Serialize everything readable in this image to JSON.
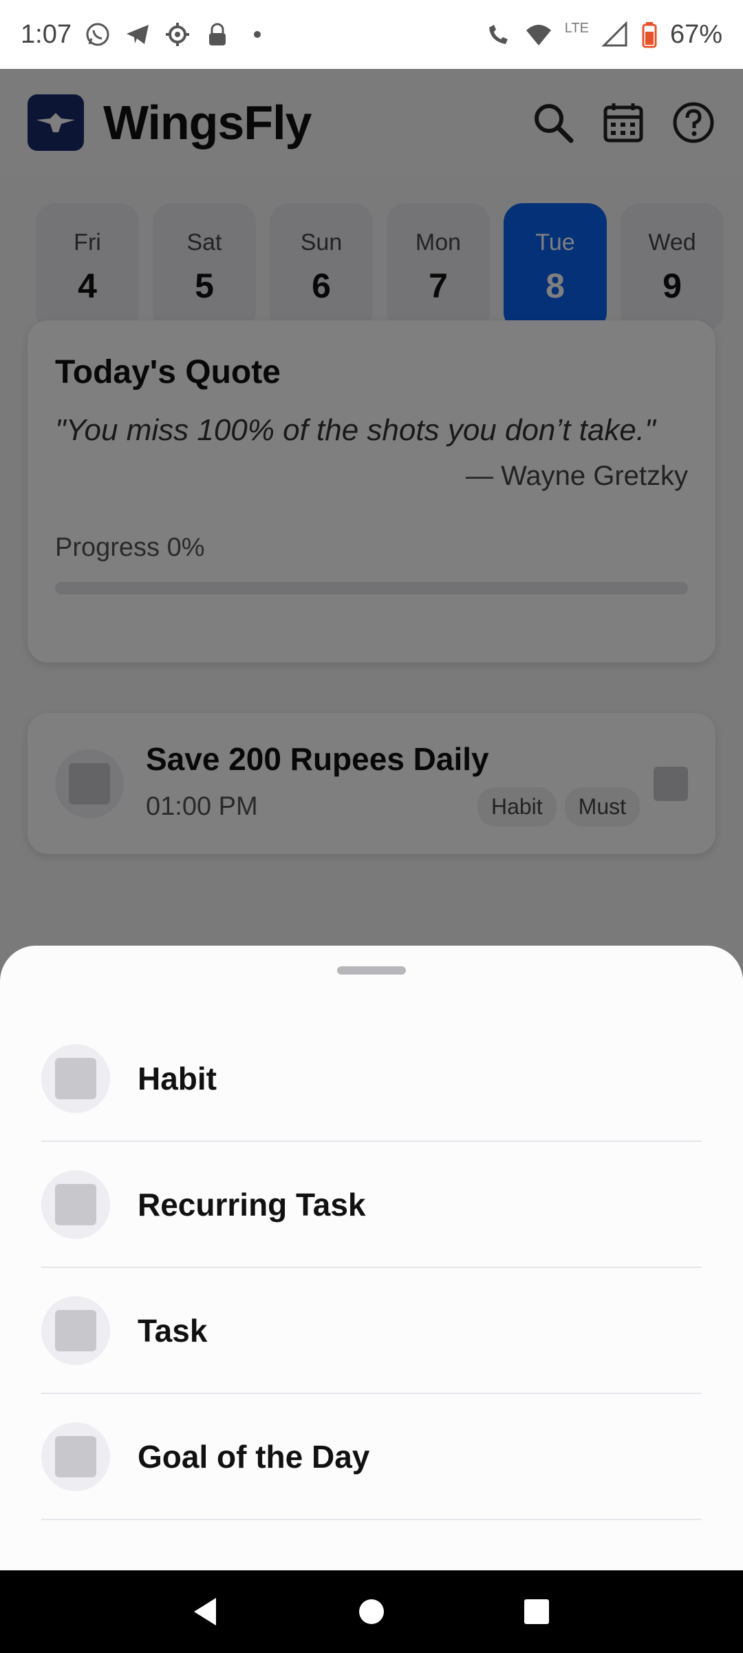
{
  "status_bar": {
    "time": "1:07",
    "lte": "LTE",
    "battery": "67%",
    "icons": [
      "whatsapp-icon",
      "telegram-icon",
      "settings-icon",
      "lock-icon",
      "dot-icon",
      "wifi-call-icon",
      "wifi-icon",
      "signal-icon",
      "battery-icon"
    ]
  },
  "header": {
    "app_name": "WingsFly",
    "icons": [
      "search-icon",
      "calendar-icon",
      "help-icon"
    ]
  },
  "dates": [
    {
      "dow": "Fri",
      "num": "4"
    },
    {
      "dow": "Sat",
      "num": "5"
    },
    {
      "dow": "Sun",
      "num": "6"
    },
    {
      "dow": "Mon",
      "num": "7"
    },
    {
      "dow": "Tue",
      "num": "8",
      "selected": true
    },
    {
      "dow": "Wed",
      "num": "9"
    }
  ],
  "quote_card": {
    "title": "Today's Quote",
    "text": "\"You miss 100% of the shots you don’t take.\"",
    "author": "— Wayne Gretzky",
    "progress_label": "Progress 0%",
    "progress_value": 0
  },
  "habit": {
    "title": "Save 200 Rupees Daily",
    "time": "01:00 PM",
    "chips": [
      "Habit",
      "Must"
    ]
  },
  "sheet": {
    "items": [
      {
        "label": "Habit"
      },
      {
        "label": "Recurring Task"
      },
      {
        "label": "Task"
      },
      {
        "label": "Goal of the Day"
      }
    ]
  },
  "colors": {
    "accent": "#0a62f0",
    "logo_bg": "#1b2a6b"
  }
}
